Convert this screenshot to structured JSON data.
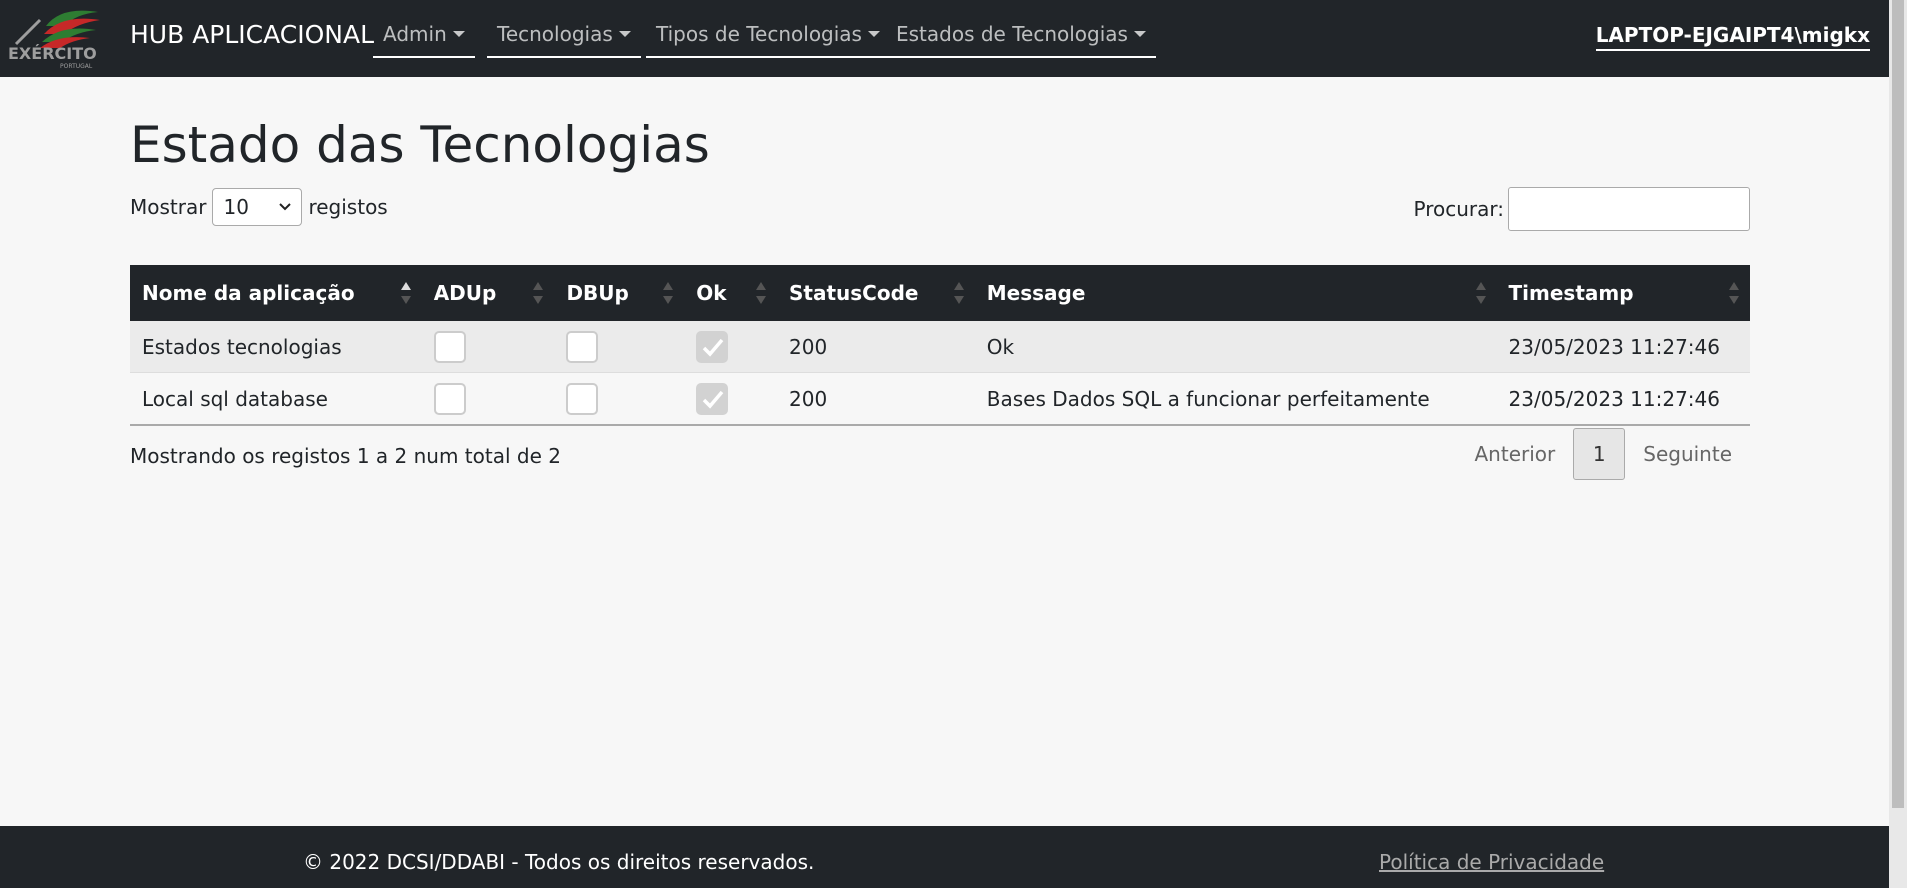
{
  "navbar": {
    "logo_text": "EXÉRCITO",
    "logo_subtext": "PORTUGAL",
    "brand": "HUB APLICACIONAL",
    "menus": [
      {
        "label": "Admin"
      },
      {
        "label": "Tecnologias"
      },
      {
        "label": "Tipos de Tecnologias"
      },
      {
        "label": "Estados de Tecnologias"
      }
    ],
    "user": "LAPTOP-EJGAIPT4\\migkx"
  },
  "page_title": "Estado das Tecnologias",
  "length_menu": {
    "prefix": "Mostrar",
    "value": "10",
    "suffix": "registos"
  },
  "search": {
    "label": "Procurar:",
    "value": ""
  },
  "table": {
    "columns": [
      "Nome da aplicação",
      "ADUp",
      "DBUp",
      "Ok",
      "StatusCode",
      "Message",
      "Timestamp"
    ],
    "sorted_column": "Nome da aplicação",
    "rows": [
      {
        "name": "Estados tecnologias",
        "adup": false,
        "dbup": false,
        "ok": true,
        "status": "200",
        "message": "Ok",
        "timestamp": "23/05/2023 11:27:46"
      },
      {
        "name": "Local sql database",
        "adup": false,
        "dbup": false,
        "ok": true,
        "status": "200",
        "message": "Bases Dados SQL a funcionar perfeitamente",
        "timestamp": "23/05/2023 11:27:46"
      }
    ]
  },
  "info": "Mostrando os registos 1 a 2 num total de 2",
  "pagination": {
    "previous": "Anterior",
    "current": "1",
    "next": "Seguinte"
  },
  "footer": {
    "copyright": "© 2022 DCSI/DDABI - Todos os direitos reservados.",
    "privacy": "Política de Privacidade"
  },
  "colors": {
    "navbar_bg": "#212529",
    "page_bg": "#f7f7f7",
    "checked_bg": "#d2d2d2"
  }
}
